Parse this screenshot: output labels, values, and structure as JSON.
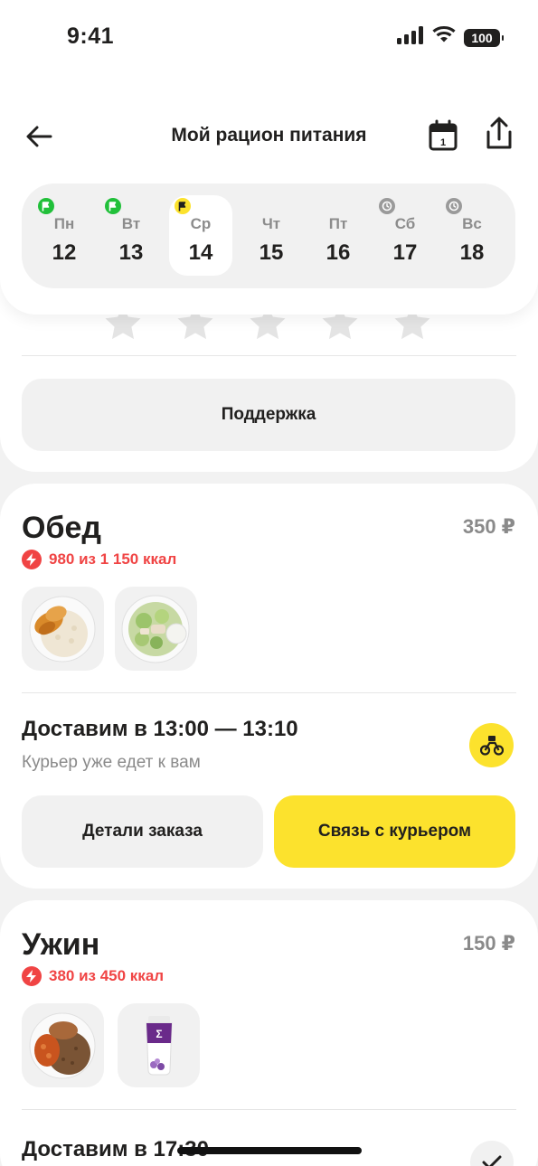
{
  "status_bar": {
    "time": "9:41",
    "battery": "100"
  },
  "header": {
    "title": "Мой рацион питания"
  },
  "week": {
    "days": [
      {
        "name": "Пн",
        "num": "12",
        "status": "done",
        "status_color": "#21c03a"
      },
      {
        "name": "Вт",
        "num": "13",
        "status": "done",
        "status_color": "#21c03a"
      },
      {
        "name": "Ср",
        "num": "14",
        "status": "current",
        "status_color": "#fce22d"
      },
      {
        "name": "Чт",
        "num": "15",
        "status": "none"
      },
      {
        "name": "Пт",
        "num": "16",
        "status": "none"
      },
      {
        "name": "Сб",
        "num": "17",
        "status": "scheduled",
        "status_color": "#9a9a9a"
      },
      {
        "name": "Вс",
        "num": "18",
        "status": "scheduled",
        "status_color": "#9a9a9a"
      }
    ],
    "selected_index": 2
  },
  "rating": {
    "stars_total": 5,
    "stars_filled": 0
  },
  "support": {
    "label": "Поддержка"
  },
  "meals": {
    "lunch": {
      "title": "Обед",
      "price": "350 ₽",
      "kcal": "980 из 1 150 ккал",
      "dishes": [
        "chicken-rice",
        "salad"
      ],
      "delivery_title": "Доставим в 13:00 — 13:10",
      "delivery_sub": "Курьер уже едет к вам",
      "details_label": "Детали заказа",
      "contact_label": "Связь с курьером"
    },
    "dinner": {
      "title": "Ужин",
      "price": "150 ₽",
      "kcal": "380 из 450 ккал",
      "dishes": [
        "meat-buckwheat",
        "yogurt-drink"
      ],
      "delivery_title": "Доставим  в  17:30"
    }
  },
  "colors": {
    "accent_yellow": "#fce22d",
    "kcal_red": "#f04444",
    "done_green": "#21c03a"
  }
}
